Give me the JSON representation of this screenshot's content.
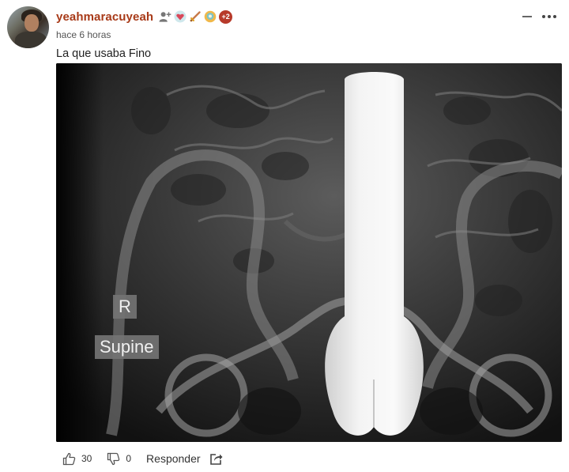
{
  "comment": {
    "author": {
      "username": "yeahmaracuyeah",
      "avatar_icon": "avatar-photo",
      "badges": [
        {
          "name": "follow-user-icon"
        },
        {
          "name": "heart-gem-badge-icon"
        },
        {
          "name": "sword-badge-icon"
        },
        {
          "name": "medal-badge-icon"
        }
      ],
      "more_badges": "+2"
    },
    "timestamp": "hace 6 horas",
    "text": "La que usaba Fino",
    "attachment": {
      "type": "xray-image",
      "labels": [
        "R",
        "Supine"
      ]
    },
    "actions": {
      "like_count": "30",
      "dislike_count": "0",
      "reply_label": "Responder"
    }
  },
  "colors": {
    "username": "#a83a18",
    "badge_more": "#b73a2a",
    "text": "#222222"
  }
}
